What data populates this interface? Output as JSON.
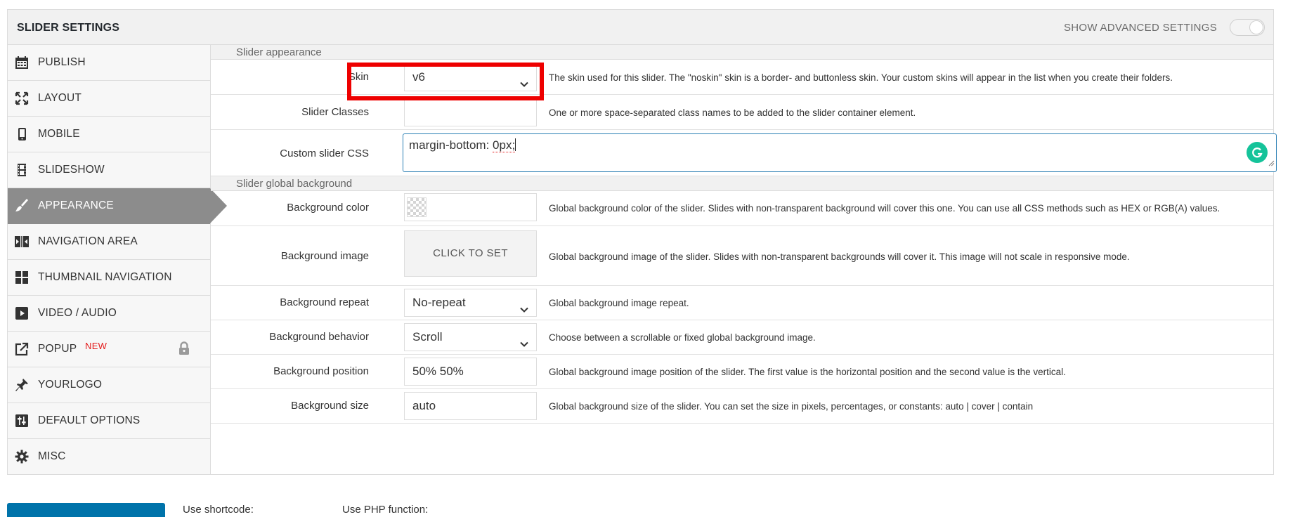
{
  "header": {
    "title": "SLIDER SETTINGS",
    "advanced_label": "SHOW ADVANCED SETTINGS"
  },
  "sidebar": {
    "items": [
      {
        "label": "PUBLISH",
        "icon": "calendar-icon"
      },
      {
        "label": "LAYOUT",
        "icon": "expand-arrows-icon"
      },
      {
        "label": "MOBILE",
        "icon": "mobile-icon"
      },
      {
        "label": "SLIDESHOW",
        "icon": "film-icon"
      },
      {
        "label": "APPEARANCE",
        "icon": "brush-icon",
        "active": true
      },
      {
        "label": "NAVIGATION AREA",
        "icon": "navigation-arrows-icon"
      },
      {
        "label": "THUMBNAIL NAVIGATION",
        "icon": "grid-icon"
      },
      {
        "label": "VIDEO / AUDIO",
        "icon": "play-icon"
      },
      {
        "label": "POPUP",
        "icon": "external-link-icon",
        "badge": "NEW",
        "locked": true
      },
      {
        "label": "YOURLOGO",
        "icon": "pin-icon"
      },
      {
        "label": "DEFAULT OPTIONS",
        "icon": "sliders-icon"
      },
      {
        "label": "MISC",
        "icon": "gear-icon"
      }
    ]
  },
  "sections": {
    "appearance": "Slider appearance",
    "background": "Slider global background"
  },
  "rows": {
    "skin": {
      "label": "Skin",
      "value": "v6",
      "desc": "The skin used for this slider. The \"noskin\" skin is a border- and buttonless skin. Your custom skins will appear in the list when you create their folders."
    },
    "classes": {
      "label": "Slider Classes",
      "value": "",
      "desc": "One or more space-separated class names to be added to the slider container element."
    },
    "css": {
      "label": "Custom slider CSS",
      "value_prefix": "margin-bottom: ",
      "value_misspelled": "0px;"
    },
    "bg_color": {
      "label": "Background color",
      "value": "",
      "desc": "Global background color of the slider. Slides with non-transparent background will cover this one. You can use all CSS methods such as HEX or RGB(A) values."
    },
    "bg_image": {
      "label": "Background image",
      "button": "CLICK TO SET",
      "desc": "Global background image of the slider. Slides with non-transparent backgrounds will cover it. This image will not scale in responsive mode."
    },
    "bg_repeat": {
      "label": "Background repeat",
      "value": "No-repeat",
      "desc": "Global background image repeat."
    },
    "bg_behavior": {
      "label": "Background behavior",
      "value": "Scroll",
      "desc": "Choose between a scrollable or fixed global background image."
    },
    "bg_position": {
      "label": "Background position",
      "value": "50% 50%",
      "desc": "Global background image position of the slider. The first value is the horizontal position and the second value is the vertical."
    },
    "bg_size": {
      "label": "Background size",
      "value": "auto",
      "desc": "Global background size of the slider. You can set the size in pixels, percentages, or constants: auto | cover | contain"
    }
  },
  "footer": {
    "shortcode_label": "Use shortcode:",
    "php_label": "Use PHP function:"
  },
  "colors": {
    "highlight": "#ee0000",
    "active_nav": "#8c8c8c",
    "primary": "#0073aa",
    "new_badge": "#e31b1b",
    "grammarly": "#15c39a"
  }
}
